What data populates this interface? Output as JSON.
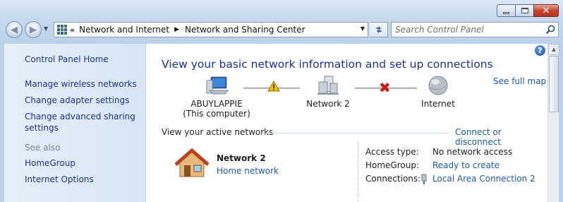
{
  "window": {
    "caption_buttons": {
      "minimize": "minimize",
      "maximize": "maximize",
      "close": "close"
    }
  },
  "navbar": {
    "back_glyph": "◀",
    "forward_glyph": "▶",
    "address": {
      "lead": "«",
      "segments": [
        "Network and Internet",
        "Network and Sharing Center"
      ],
      "separator": "▶"
    },
    "search": {
      "placeholder": "Search Control Panel",
      "value": ""
    }
  },
  "sidebar": {
    "items": [
      {
        "label": "Control Panel Home"
      },
      {
        "label": "Manage wireless networks"
      },
      {
        "label": "Change adapter settings"
      },
      {
        "label": "Change advanced sharing settings"
      }
    ],
    "see_also_label": "See also",
    "see_also_items": [
      {
        "label": "HomeGroup"
      },
      {
        "label": "Internet Options"
      }
    ]
  },
  "main": {
    "heading": "View your basic network information and set up connections",
    "see_full_map": "See full map",
    "map": {
      "computer": {
        "name": "ABUYLAPPIE",
        "subtitle": "(This computer)"
      },
      "network": {
        "name": "Network  2"
      },
      "internet": {
        "name": "Internet"
      }
    },
    "active_networks_title": "View your active networks",
    "connect_disconnect": "Connect or disconnect",
    "active_network": {
      "name": "Network  2",
      "type": "Home network",
      "access_type_label": "Access type:",
      "access_type_value": "No network access",
      "homegroup_label": "HomeGroup:",
      "homegroup_value": "Ready to create",
      "connections_label": "Connections:",
      "connections_value": "Local Area Connection 2"
    }
  },
  "colors": {
    "link": "#1e5aa8",
    "heading": "#1e3287",
    "sidebar_link": "#1e3287",
    "warning": "#f2c200",
    "error": "#d01818"
  },
  "icons": [
    "search-icon",
    "help-icon",
    "computer-icon",
    "network-icon",
    "globe-icon",
    "warning-icon",
    "x-icon",
    "house-icon",
    "connection-icon",
    "refresh-icon",
    "control-panel-icon"
  ]
}
